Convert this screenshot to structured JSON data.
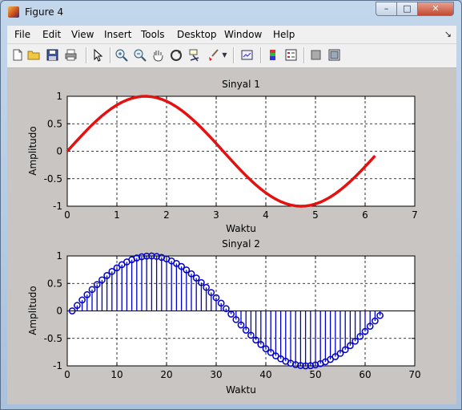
{
  "window": {
    "title": "Figure 4",
    "minimize_glyph": "–",
    "maximize_glyph": "□",
    "close_glyph": "✕"
  },
  "menu": [
    "File",
    "Edit",
    "View",
    "Insert",
    "Tools",
    "Desktop",
    "Window",
    "Help"
  ],
  "menu_arrow_glyph": "↘",
  "toolbar_icons": [
    "new-figure-icon",
    "open-file-icon",
    "save-icon",
    "print-icon",
    "pointer-arrow-icon",
    "zoom-in-icon",
    "zoom-out-icon",
    "pan-hand-icon",
    "rotate-3d-icon",
    "data-cursor-icon",
    "brush-icon",
    "brush-dropdown-icon",
    "link-plot-icon",
    "colorbar-icon",
    "legend-icon",
    "hide-plot-tools-icon",
    "show-plot-tools-icon"
  ],
  "colors": {
    "sinyal1_line": "#e41111",
    "sinyal2_stem": "#0000c8",
    "axes_bg": "#ffffff",
    "figure_bg": "#c8c5c2"
  },
  "chart_data": [
    {
      "type": "line",
      "title": "Sinyal 1",
      "xlabel": "Waktu",
      "ylabel": "Amplitudo",
      "xlim": [
        0,
        7
      ],
      "ylim": [
        -1,
        1
      ],
      "xticks": [
        0,
        1,
        2,
        3,
        4,
        5,
        6,
        7
      ],
      "yticks": [
        1,
        0.5,
        0,
        -0.5,
        -1
      ],
      "grid": true,
      "series": [
        {
          "function": "sin(x)",
          "x_start": 0,
          "x_end": 6.2,
          "x_step": 0.1
        }
      ]
    },
    {
      "type": "stem",
      "title": "Sinyal 2",
      "xlabel": "Waktu",
      "ylabel": "Amplitudo",
      "xlim": [
        0,
        70
      ],
      "ylim": [
        -1,
        1
      ],
      "xticks": [
        0,
        10,
        20,
        30,
        40,
        50,
        60,
        70
      ],
      "yticks": [
        1,
        0.5,
        0,
        -0.5,
        -1
      ],
      "grid": true,
      "series": [
        {
          "function": "sin(0.1*(n-1))",
          "n_start": 1,
          "n_end": 63,
          "marker": "circle"
        }
      ]
    }
  ]
}
